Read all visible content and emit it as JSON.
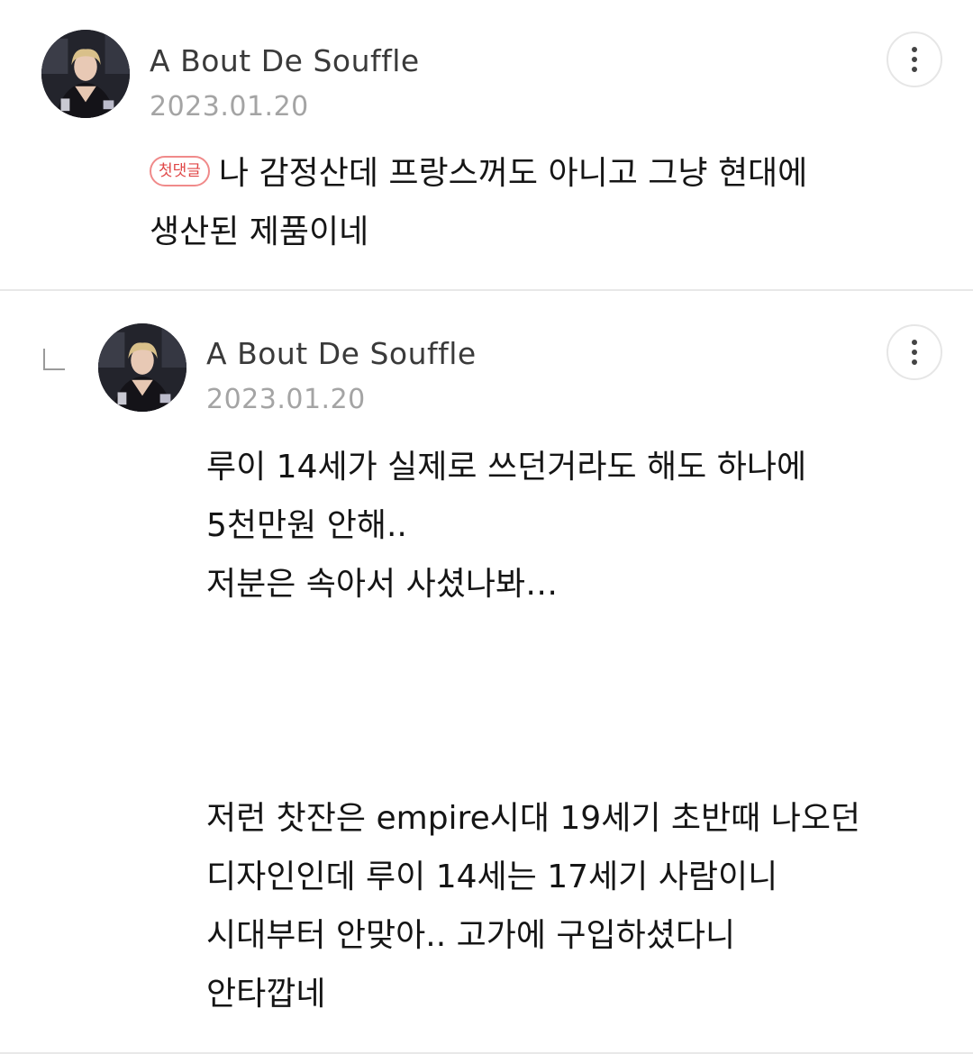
{
  "comments": [
    {
      "author": "A Bout De Souffle",
      "date": "2023.01.20",
      "badge": "첫댓글",
      "lines": [
        "나 감정산데 프랑스꺼도 아니고 그냥 현대에",
        "생산된 제품이네"
      ]
    },
    {
      "author": "A Bout De Souffle",
      "date": "2023.01.20",
      "lines": [
        "루이 14세가 실제로 쓰던거라도 해도 하나에",
        "5천만원 안해..",
        "저분은 속아서 사셨나봐…",
        "",
        "",
        "",
        "저런 찻잔은 empire시대 19세기 초반때 나오던",
        "디자인인데 루이 14세는 17세기 사람이니",
        "시대부터 안맞아.. 고가에 구입하셨다니",
        "안타깝네"
      ]
    }
  ],
  "icons": {
    "more": "more-vertical-icon",
    "reply": "reply-arrow-icon"
  },
  "colors": {
    "badge": "#e04646",
    "divider": "#e8e8e8",
    "date": "#a4a4a4"
  }
}
